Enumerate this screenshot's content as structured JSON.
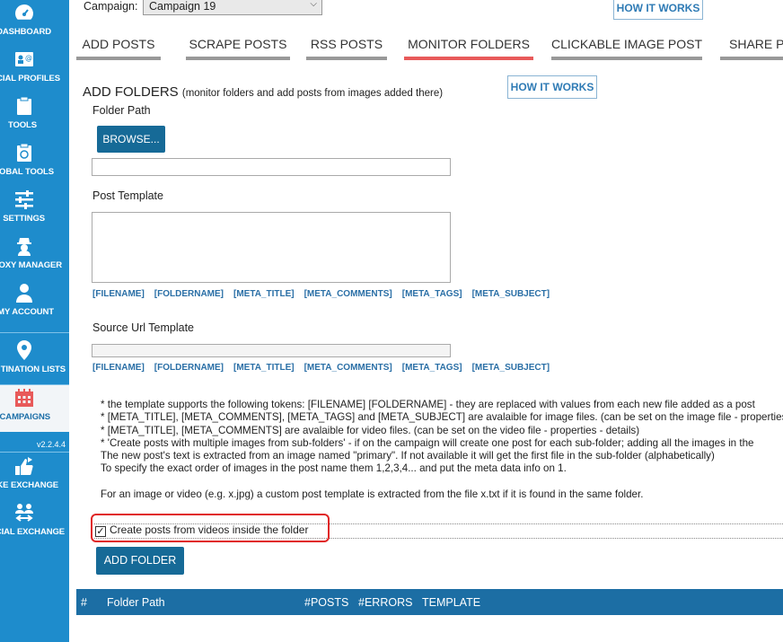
{
  "sidebar": {
    "items": [
      {
        "label": "DASHBOARD",
        "icon": "dashboard-icon"
      },
      {
        "label": "CIAL PROFILES",
        "icon": "profiles-icon"
      },
      {
        "label": "TOOLS",
        "icon": "clipboard-icon"
      },
      {
        "label": "LOBAL TOOLS",
        "icon": "clipboard-icon"
      },
      {
        "label": "SETTINGS",
        "icon": "sliders-icon"
      },
      {
        "label": "OXY MANAGER",
        "icon": "proxy-icon"
      },
      {
        "label": "MY ACCOUNT",
        "icon": "user-icon"
      },
      {
        "label": "TINATION LISTS",
        "icon": "map-pin-icon"
      },
      {
        "label": "CAMPAIGNS",
        "icon": "calendar-icon"
      },
      {
        "label": "KE EXCHANGE",
        "icon": "exchange-icon"
      },
      {
        "label": "CIAL EXCHANGE",
        "icon": "people-exchange-icon"
      }
    ],
    "version": "v2.2.4.4",
    "active_color": "#f2f5f8",
    "bg_color": "#1e8ccc"
  },
  "campaign": {
    "label": "Campaign:",
    "value": "Campaign 19"
  },
  "how_it_works": "HOW IT WORKS",
  "tabs": [
    {
      "label": "ADD POSTS",
      "active": false
    },
    {
      "label": "SCRAPE POSTS",
      "active": false
    },
    {
      "label": "RSS POSTS",
      "active": false
    },
    {
      "label": "MONITOR FOLDERS",
      "active": true
    },
    {
      "label": "CLICKABLE IMAGE POST",
      "active": false
    },
    {
      "label": "SHARE PO",
      "active": false
    }
  ],
  "section": {
    "title": "ADD FOLDERS",
    "subtitle": "(monitor folders and add posts from images added there)",
    "how_it_works": "HOW IT WORKS"
  },
  "folder_path": {
    "label": "Folder Path",
    "browse": "BROWSE...",
    "value": ""
  },
  "post_template": {
    "label": "Post Template",
    "value": ""
  },
  "source_url": {
    "label": "Source Url Template",
    "value": ""
  },
  "tokens": [
    "[FILENAME]",
    "[FOLDERNAME]",
    "[META_TITLE]",
    "[META_COMMENTS]",
    "[META_TAGS]",
    "[META_SUBJECT]"
  ],
  "notes": [
    "* the template supports the following tokens:  [FILENAME]  [FOLDERNAME]  - they are replaced with values from each new file added as a post",
    "* [META_TITLE], [META_COMMENTS], [META_TAGS] and [META_SUBJECT] are avalaible for image files. (can be set on the image file - properties -",
    "* [META_TITLE], [META_COMMENTS] are avalaible for video files. (can be set on the video file - properties - details)",
    "* 'Create posts with multiple images from sub-folders' - if on the campaign will create one post for each sub-folder; adding all the images in the",
    "The new post's text is extracted from an image named \"primary\". If not available it will get the first file in the sub-folder (alphabetically)",
    "To specify the exact order of images in the post name them 1,2,3,4...  and put the meta data info on 1."
  ],
  "note_extra": "For an image or video (e.g. x.jpg) a custom post template is extracted from the file x.txt if it is found in the same folder.",
  "checkbox": {
    "label": "Create posts from videos inside the folder",
    "checked": true
  },
  "add_folder": "ADD FOLDER",
  "table": {
    "columns": [
      "#",
      "Folder Path",
      "#POSTS",
      "#ERRORS",
      "TEMPLATE"
    ]
  },
  "colors": {
    "accent": "#166a97",
    "active_tab": "#e85a5a",
    "highlight": "#e02424",
    "token": "#2a6fa6"
  }
}
